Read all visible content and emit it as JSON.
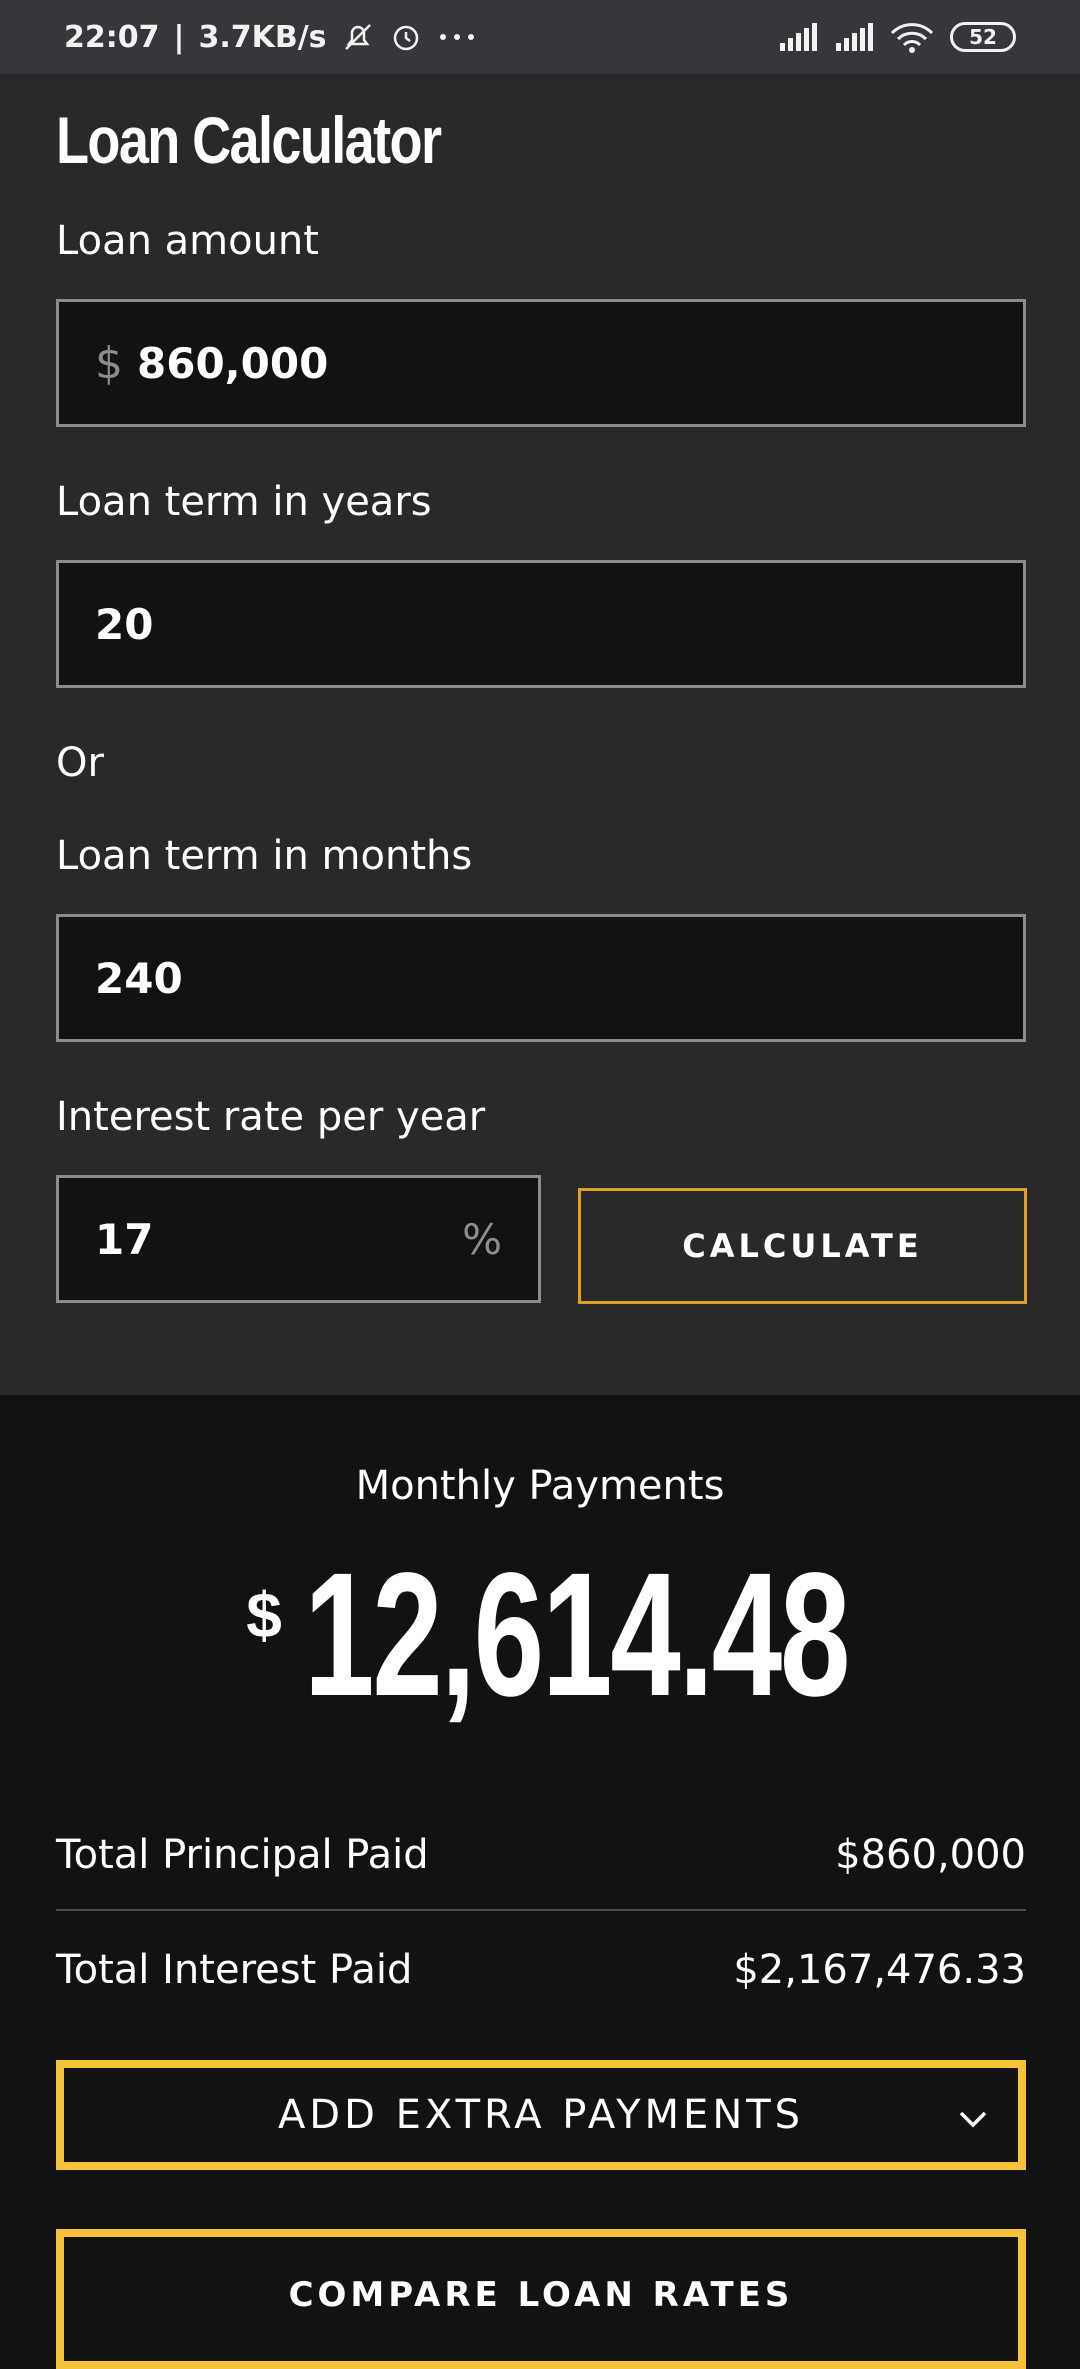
{
  "status_bar": {
    "time": "22:07",
    "network_speed": "3.7KB/s",
    "battery_level": "52",
    "icons": [
      "mute-icon",
      "alarm-icon",
      "more-icon",
      "signal-icon",
      "signal-icon",
      "wifi-icon",
      "battery-icon"
    ]
  },
  "page": {
    "title": "Loan Calculator"
  },
  "form": {
    "loan_amount_label": "Loan amount",
    "loan_amount_prefix": "$",
    "loan_amount_value": "860,000",
    "term_years_label": "Loan term in years",
    "term_years_value": "20",
    "or_label": "Or",
    "term_months_label": "Loan term in months",
    "term_months_value": "240",
    "interest_label": "Interest rate per year",
    "interest_value": "17",
    "interest_suffix": "%",
    "calculate_label": "CALCULATE"
  },
  "results": {
    "monthly_label": "Monthly Payments",
    "monthly_currency": "$",
    "monthly_amount": "12,614.48",
    "principal_label": "Total Principal Paid",
    "principal_value": "$860,000",
    "interest_label": "Total Interest Paid",
    "interest_value": "$2,167,476.33",
    "extra_payments_label": "ADD EXTRA PAYMENTS",
    "compare_rates_label": "COMPARE LOAN RATES"
  },
  "colors": {
    "accent_yellow": "#f6c23a",
    "calculate_border": "#e0a21e",
    "form_bg": "#29292b",
    "results_bg": "#121212"
  }
}
